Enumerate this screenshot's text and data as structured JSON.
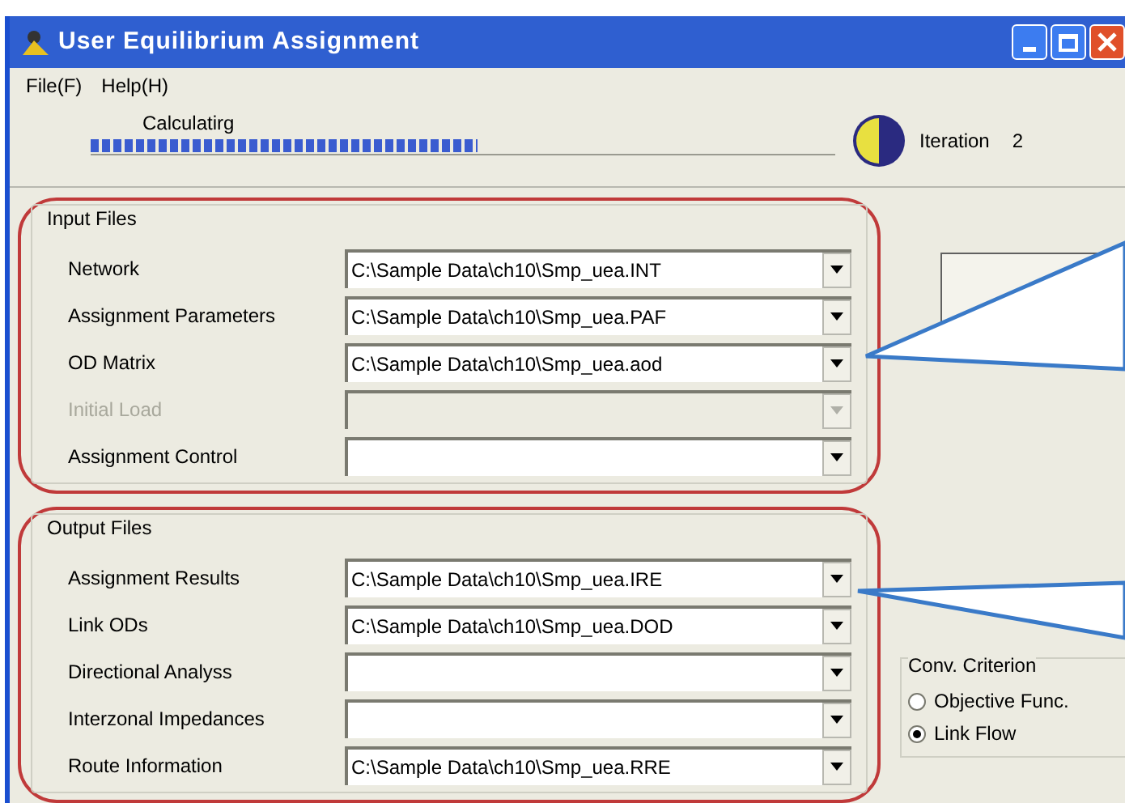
{
  "window": {
    "title": "User Equilibrium Assignment"
  },
  "menu": [
    "File(F)",
    "Help(H)"
  ],
  "progress": {
    "label": "Calculatirg",
    "level": 0.52
  },
  "iteration": {
    "label": "Iteration",
    "value": "2"
  },
  "groups": [
    {
      "title": "Input Files",
      "rows": [
        {
          "label": "Network",
          "value": "C:\\Sample Data\\ch10\\Smp_uea.INT",
          "disabled": false
        },
        {
          "label": "Assignment Parameters",
          "value": "C:\\Sample Data\\ch10\\Smp_uea.PAF",
          "disabled": false
        },
        {
          "label": "OD Matrix",
          "value": "C:\\Sample Data\\ch10\\Smp_uea.aod",
          "disabled": false
        },
        {
          "label": "Initial Load",
          "disabled": true
        },
        {
          "label": "Assignment Control",
          "disabled": false
        }
      ]
    },
    {
      "title": "Output Files",
      "rows": [
        {
          "label": "Assignment Results",
          "value": "C:\\Sample Data\\ch10\\Smp_uea.IRE",
          "disabled": false
        },
        {
          "label": "Link ODs",
          "value": "C:\\Sample Data\\ch10\\Smp_uea.DOD",
          "disabled": false
        },
        {
          "label": "Directional Analyss",
          "disabled": false
        },
        {
          "label": "Interzonal Impedances",
          "disabled": false
        },
        {
          "label": "Route Information",
          "value": "C:\\Sample Data\\ch10\\Smp_uea.RRE",
          "disabled": false
        }
      ]
    }
  ],
  "criterion": {
    "title": "Conv. Criterion",
    "options": [
      {
        "label": "Objective Func.",
        "selected": false
      },
      {
        "label": "Link Flow",
        "selected": true
      }
    ]
  }
}
